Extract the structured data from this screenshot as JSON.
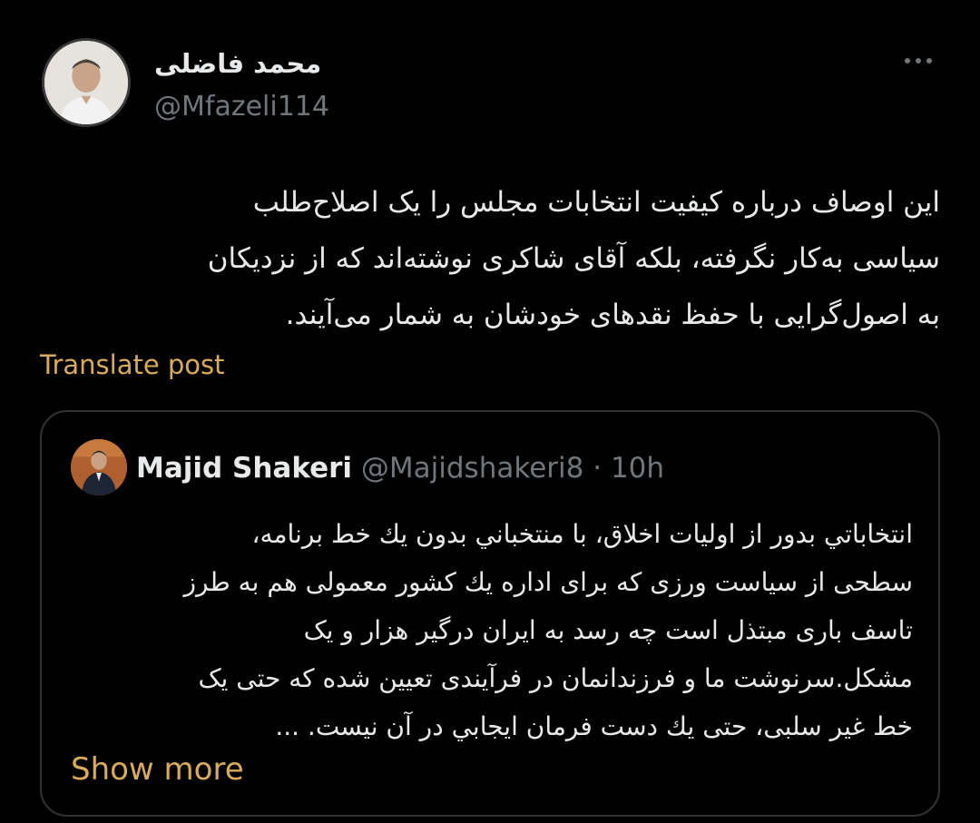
{
  "author": {
    "display_name": "محمد فاضلی",
    "handle": "@Mfazeli114",
    "avatar_icon": "profile-photo"
  },
  "post": {
    "lines": [
      "این اوصاف درباره کیفیت انتخابات مجلس را یک اصلاح‌طلب",
      "سیاسی به‌کار نگرفته، بلکه آقای شاکری نوشته‌اند که از نزدیکان",
      "به اصول‌گرایی با حفظ نقدهای خودشان به شمار می‌آیند."
    ]
  },
  "translate_label": "Translate post",
  "quoted": {
    "display_name": "Majid Shakeri",
    "handle": "@Majidshakeri8",
    "separator": "·",
    "time": "10h",
    "lines": [
      "انتخاباتي بدور از اولیات اخلاق، با منتخباني بدون يك خط برنامه،",
      "سطحی از سیاست ورزی که برای اداره يك كشور معمولی هم به طرز",
      "تاسف باری مبتذل است چه رسد به ایران درگیر هزار و یک",
      "مشكل.سرنوشت ما و فرزندانمان در فرآیندی تعیین شده که حتی یک",
      "خط غیر سلبی، حتی يك دست فرمان ایجابي در آن نیست. ..."
    ],
    "show_more_label": "Show more"
  },
  "colors": {
    "background": "#000000",
    "text": "#e7e9ea",
    "muted": "#71767b",
    "accent": "#d9ab5b",
    "border": "#2f3336"
  }
}
